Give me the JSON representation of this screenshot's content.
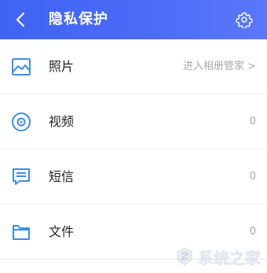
{
  "header": {
    "back_icon": "chevron-left-icon",
    "title": "隐私保护",
    "settings_icon": "gear-icon"
  },
  "items": [
    {
      "label": "照片",
      "value": "进入相册管家 >",
      "icon": "image-icon"
    },
    {
      "label": "视频",
      "value": "0",
      "icon": "video-disc-icon"
    },
    {
      "label": "短信",
      "value": "0",
      "icon": "message-icon"
    },
    {
      "label": "文件",
      "value": "0",
      "icon": "folder-icon"
    }
  ],
  "watermark": {
    "text": "系统之家"
  },
  "colors": {
    "accent": "#4a6af5",
    "icon": "#3b8cf0"
  }
}
